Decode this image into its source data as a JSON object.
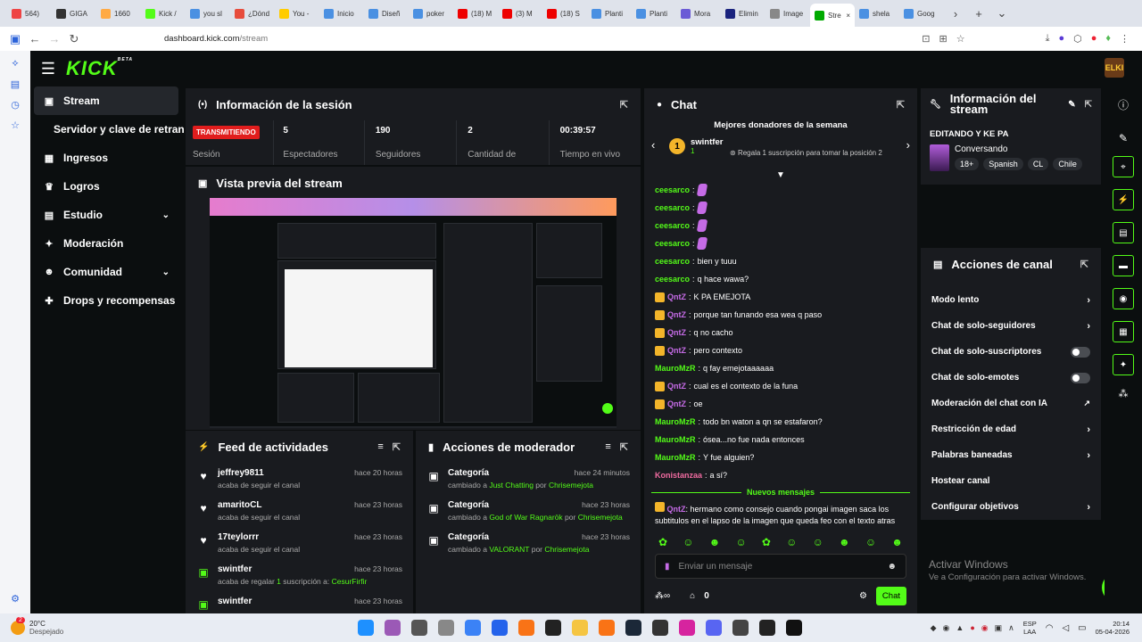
{
  "browser": {
    "tabs": [
      "564)",
      "GIGA",
      "1660",
      "Kick /",
      "you sl",
      "¿Dónd",
      "You -",
      "Inicio",
      "Diseñ",
      "poker",
      "(18) M",
      "(3) M",
      "(18) S",
      "Planti",
      "Planti",
      "Mora",
      "Elimin",
      "Image",
      "Stre",
      "shela",
      "Goog"
    ],
    "active_tab_index": 18,
    "url_host": "dashboard.kick.com",
    "url_path": "/stream"
  },
  "brand": {
    "logo": "KICK",
    "beta": "BETA",
    "avatar": "ELKI"
  },
  "sidebar": {
    "items": [
      {
        "label": "Stream",
        "icon": "tv-icon"
      },
      {
        "label": "Servidor y clave de retransmisión"
      },
      {
        "label": "Ingresos",
        "icon": "chart-icon"
      },
      {
        "label": "Logros",
        "icon": "trophy-icon"
      },
      {
        "label": "Estudio",
        "icon": "studio-icon"
      },
      {
        "label": "Moderación",
        "icon": "wrench-icon"
      },
      {
        "label": "Comunidad",
        "icon": "people-icon"
      },
      {
        "label": "Drops y recompensas",
        "icon": "gift-icon"
      }
    ]
  },
  "session": {
    "title": "Información de la sesión",
    "live_badge": "TRANSMITIENDO",
    "session_label": "Sesión",
    "stats": [
      {
        "value": "5",
        "label": "Espectadores"
      },
      {
        "value": "190",
        "label": "Seguidores"
      },
      {
        "value": "2",
        "label": "Cantidad de"
      },
      {
        "value": "00:39:57",
        "label": "Tiempo en vivo"
      }
    ]
  },
  "preview": {
    "title": "Vista previa del stream"
  },
  "activity": {
    "title": "Feed de actividades",
    "items": [
      {
        "user": "jeffrey9811",
        "time": "hace 20 horas",
        "text": "acaba de seguir el canal"
      },
      {
        "user": "amaritoCL",
        "time": "hace 23 horas",
        "text": "acaba de seguir el canal"
      },
      {
        "user": "17teylorrr",
        "time": "hace 23 horas",
        "text": "acaba de seguir el canal"
      },
      {
        "user": "swintfer",
        "time": "hace 23 horas",
        "text_pre": "acaba de regalar ",
        "count": "1",
        "text_mid": " suscripción a: ",
        "target": "CesurFirfir"
      },
      {
        "user": "swintfer",
        "time": "hace 23 horas"
      }
    ]
  },
  "modactions": {
    "title": "Acciones de moderador",
    "items": [
      {
        "type": "Categoría",
        "time": "hace 24 minutos",
        "pre": "cambiado a ",
        "cat": "Just Chatting",
        "by": " por ",
        "mod": "Chrisemejota"
      },
      {
        "type": "Categoría",
        "time": "hace 23 horas",
        "pre": "cambiado a ",
        "cat": "God of War Ragnarök",
        "by": " por ",
        "mod": "Chrisemejota"
      },
      {
        "type": "Categoría",
        "time": "hace 23 horas",
        "pre": "cambiado a ",
        "cat": "VALORANT",
        "by": " por ",
        "mod": "Chrisemejota"
      }
    ]
  },
  "chat": {
    "title": "Chat",
    "top_donors": "Mejores donadores de la semana",
    "donor": {
      "rank": "1",
      "name": "swintfer",
      "count": "1"
    },
    "gift_cta": "Regala 1 suscripción para tomar la posición 2",
    "messages": [
      {
        "user": "ceesarco",
        "text": "",
        "emote": true,
        "color": "green"
      },
      {
        "user": "ceesarco",
        "text": "",
        "emote": true,
        "color": "green"
      },
      {
        "user": "ceesarco",
        "text": "",
        "emote": true,
        "color": "green"
      },
      {
        "user": "ceesarco",
        "text": "",
        "emote": true,
        "color": "green"
      },
      {
        "user": "ceesarco",
        "text": "bien y tuuu",
        "color": "green"
      },
      {
        "user": "ceesarco",
        "text": "q hace wawa?",
        "color": "green"
      },
      {
        "user": "QntZ",
        "text": "K PA EMEJOTA",
        "color": "purple",
        "badge": true
      },
      {
        "user": "QntZ",
        "text": "porque tan funando esa wea q paso",
        "color": "purple",
        "badge": true
      },
      {
        "user": "QntZ",
        "text": "q no cacho",
        "color": "purple",
        "badge": true
      },
      {
        "user": "QntZ",
        "text": "pero contexto",
        "color": "purple",
        "badge": true
      },
      {
        "user": "MauroMzR",
        "text": "q fay emejotaaaaaa",
        "color": "green"
      },
      {
        "user": "QntZ",
        "text": "cual es el contexto de la funa",
        "color": "purple",
        "badge": true
      },
      {
        "user": "QntZ",
        "text": "oe",
        "color": "purple",
        "badge": true
      },
      {
        "user": "MauroMzR",
        "text": "todo bn waton a qn se estafaron?",
        "color": "green"
      },
      {
        "user": "MauroMzR",
        "text": "ósea...no fue nada entonces",
        "color": "green"
      },
      {
        "user": "MauroMzR",
        "text": "Y fue alguien?",
        "color": "green"
      },
      {
        "user": "Konistanzaa",
        "text": "a sí?",
        "color": "pink"
      }
    ],
    "new_messages": "Nuevos mensajes",
    "last_message": {
      "user": "QntZ",
      "line1": "hermano como consejo cuando pongai imagen saca los",
      "line2": "subtitulos en el lapso de la imagen que queda feo con el texto atras"
    },
    "input_placeholder": "Enviar un mensaje",
    "points": "0",
    "send_label": "Chat"
  },
  "stream_info": {
    "title": "Información del stream",
    "stream_title": "EDITANDO Y KE PA",
    "category": "Conversando",
    "tags": [
      "18+",
      "Spanish",
      "CL",
      "Chile"
    ]
  },
  "channel_actions": {
    "title": "Acciones de canal",
    "items": [
      {
        "label": "Modo lento",
        "control": "chevron"
      },
      {
        "label": "Chat de solo-seguidores",
        "control": "chevron"
      },
      {
        "label": "Chat de solo-suscriptores",
        "control": "toggle"
      },
      {
        "label": "Chat de solo-emotes",
        "control": "toggle"
      },
      {
        "label": "Moderación del chat con IA",
        "control": "external"
      },
      {
        "label": "Restricción de edad",
        "control": "chevron"
      },
      {
        "label": "Palabras baneadas",
        "control": "chevron"
      },
      {
        "label": "Hostear canal",
        "control": "none"
      },
      {
        "label": "Configurar objetivos",
        "control": "chevron"
      }
    ]
  },
  "windows_watermark": {
    "title": "Activar Windows",
    "subtitle": "Ve a Configuración para activar Windows."
  },
  "taskbar": {
    "notif_count": "2",
    "temp": "20°C",
    "weather": "Despejado",
    "lang1": "ESP",
    "lang2": "LAA",
    "time": "20:14",
    "date": "05-04-2026"
  }
}
